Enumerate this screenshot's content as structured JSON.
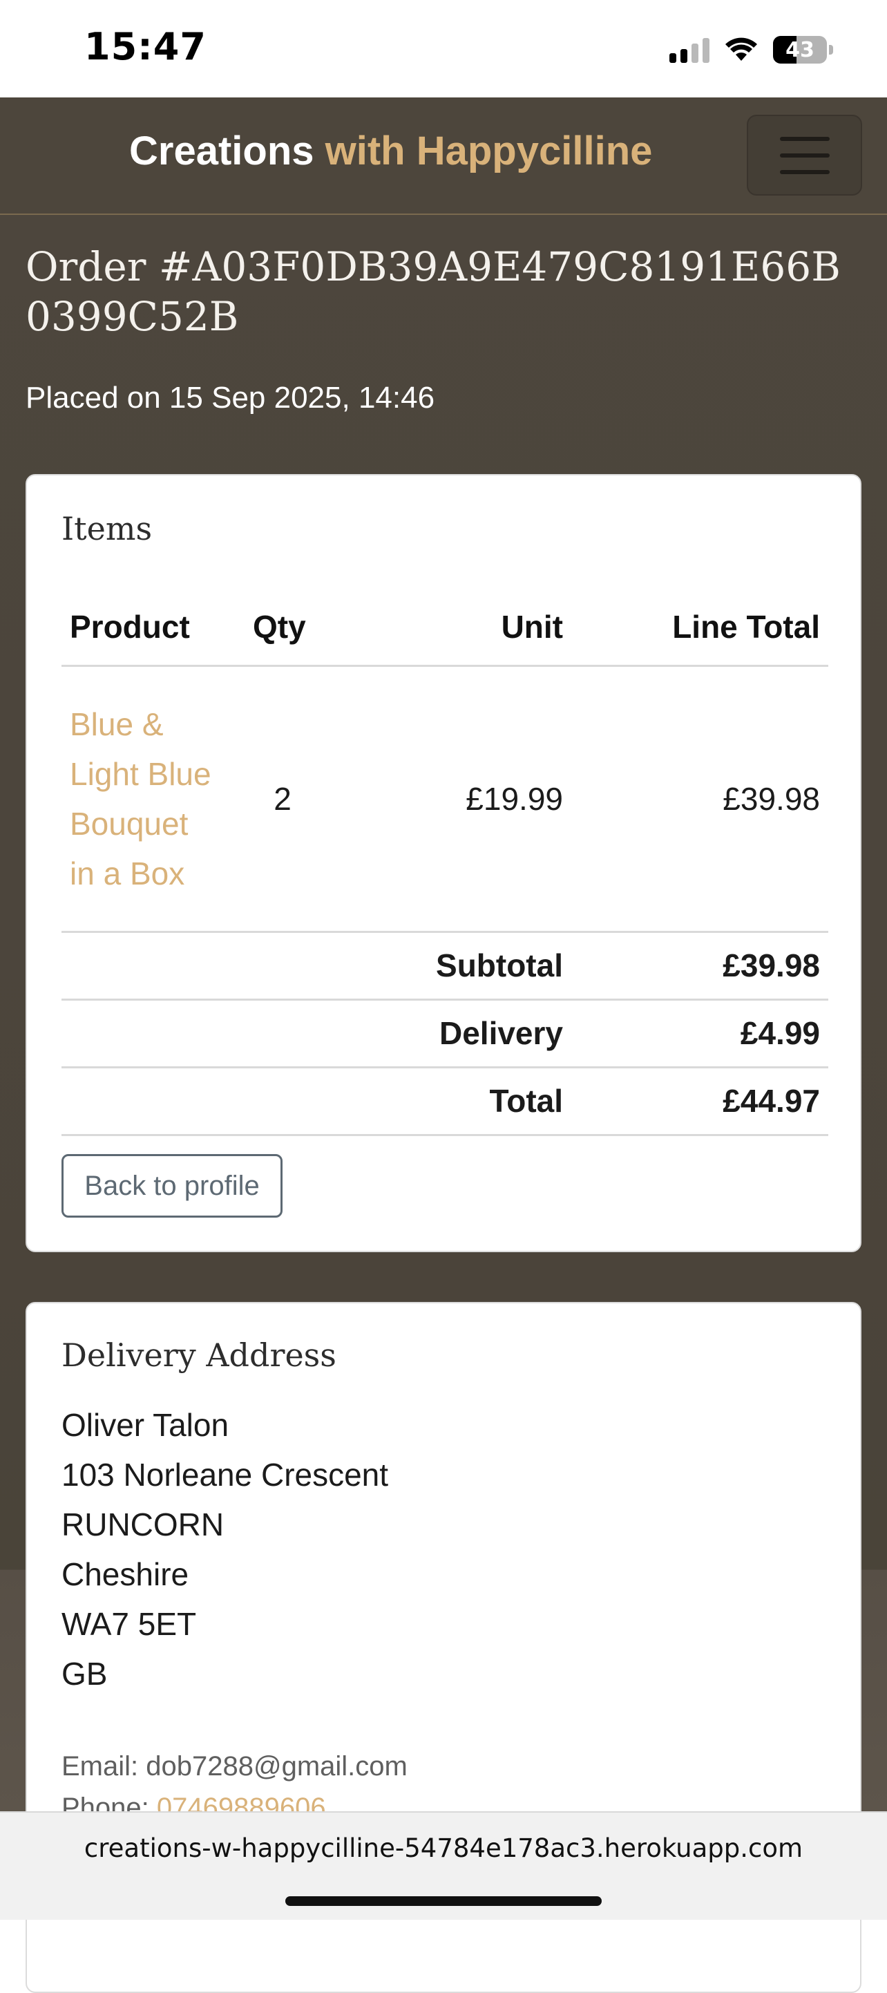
{
  "status_bar": {
    "time": "15:47",
    "battery_pct": "43",
    "battery_level": 0.43,
    "icons": [
      "cellular-signal-icon",
      "wifi-icon",
      "battery-icon"
    ]
  },
  "navbar": {
    "brand_main": "Creations",
    "brand_accent": "with Happycilline",
    "accent_color": "#d9b27a",
    "menu_icon": "hamburger-menu-icon"
  },
  "order": {
    "title": "Order #A03F0DB39A9E479C8191E66B0399C52B",
    "placed_on": "Placed on 15 Sep 2025, 14:46"
  },
  "items_card": {
    "heading": "Items",
    "columns": [
      "Product",
      "Qty",
      "Unit",
      "Line Total"
    ],
    "rows": [
      {
        "product": "Blue & Light Blue Bouquet in a Box",
        "qty": "2",
        "unit": "£19.99",
        "line_total": "£39.98"
      }
    ],
    "summary": [
      {
        "label": "Subtotal",
        "value": "£39.98"
      },
      {
        "label": "Delivery",
        "value": "£4.99"
      },
      {
        "label": "Total",
        "value": "£44.97"
      }
    ],
    "back_button": "Back to profile"
  },
  "address_card": {
    "heading": "Delivery Address",
    "lines": [
      "Oliver Talon",
      "103 Norleane Crescent",
      "RUNCORN",
      "Cheshire",
      "WA7 5ET",
      "GB"
    ],
    "email_label": "Email:",
    "email": "dob7288@gmail.com",
    "phone_label": "Phone:",
    "phone": "07469889606"
  },
  "browser": {
    "url": "creations-w-happycilline-54784e178ac3.herokuapp.com"
  }
}
